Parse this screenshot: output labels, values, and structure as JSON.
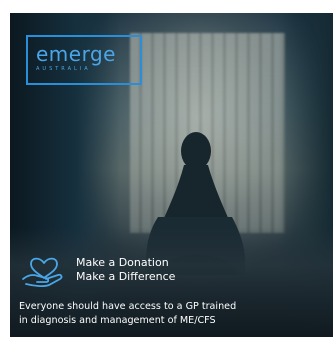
{
  "logo": {
    "text": "emerge",
    "subtext": "AUSTRALIA",
    "color": "#2a8fd8"
  },
  "donation": {
    "icon": "hand-heart-icon",
    "line1": "Make a Donation",
    "line2": "Make a Difference"
  },
  "tagline": {
    "line1": "Everyone should have access to a GP trained",
    "line2": "in diagnosis and management of ME/CFS"
  },
  "colors": {
    "accent": "#2a8fd8",
    "text": "#ffffff"
  }
}
